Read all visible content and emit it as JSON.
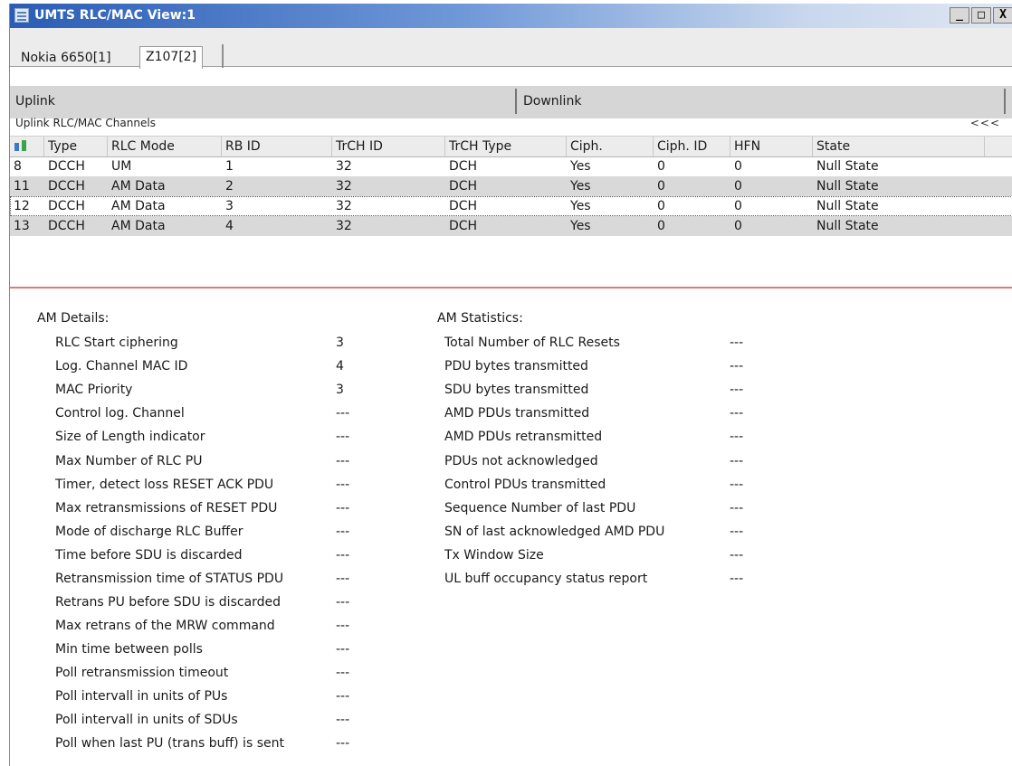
{
  "window": {
    "title": "UMTS RLC/MAC View:1",
    "controls": [
      "_",
      "□",
      "X"
    ]
  },
  "tabs": [
    {
      "label": "Nokia 6650[1]",
      "selected": false
    },
    {
      "label": "Z107[2]",
      "selected": true
    }
  ],
  "directions": {
    "uplink": "Uplink",
    "downlink": "Downlink"
  },
  "channels": {
    "title": "Uplink RLC/MAC Channels",
    "collapse_label": "<<<",
    "columns": [
      "",
      "Type",
      "RLC Mode",
      "RB ID",
      "TrCH ID",
      "TrCH Type",
      "Ciph.",
      "Ciph. ID",
      "HFN",
      "State"
    ],
    "rows": [
      [
        "8",
        "DCCH",
        "UM",
        "1",
        "32",
        "DCH",
        "Yes",
        "0",
        "0",
        "Null State"
      ],
      [
        "11",
        "DCCH",
        "AM Data",
        "2",
        "32",
        "DCH",
        "Yes",
        "0",
        "0",
        "Null State"
      ],
      [
        "12",
        "DCCH",
        "AM Data",
        "3",
        "32",
        "DCH",
        "Yes",
        "0",
        "0",
        "Null State"
      ],
      [
        "13",
        "DCCH",
        "AM Data",
        "4",
        "32",
        "DCH",
        "Yes",
        "0",
        "0",
        "Null State"
      ]
    ],
    "selected_row": 2
  },
  "am_details": {
    "title": "AM Details:",
    "items": [
      {
        "label": "RLC Start ciphering",
        "value": "3"
      },
      {
        "label": "Log. Channel MAC ID",
        "value": "4"
      },
      {
        "label": "MAC Priority",
        "value": "3"
      },
      {
        "label": "Control log. Channel",
        "value": "---"
      },
      {
        "label": "Size of Length indicator",
        "value": "---"
      },
      {
        "label": "Max Number of RLC PU",
        "value": "---"
      },
      {
        "label": "Timer, detect loss RESET ACK PDU",
        "value": "---"
      },
      {
        "label": "Max retransmissions of RESET PDU",
        "value": "---"
      },
      {
        "label": "Mode of discharge RLC Buffer",
        "value": "---"
      },
      {
        "label": "Time before SDU is discarded",
        "value": "---"
      },
      {
        "label": "Retransmission time of STATUS PDU",
        "value": "---"
      },
      {
        "label": "Retrans PU before SDU is discarded",
        "value": "---"
      },
      {
        "label": "Max retrans of the MRW command",
        "value": "---"
      },
      {
        "label": "Min time between polls",
        "value": "---"
      },
      {
        "label": "Poll retransmission timeout",
        "value": "---"
      },
      {
        "label": "Poll intervall in units of PUs",
        "value": "---"
      },
      {
        "label": "Poll intervall in units of SDUs",
        "value": "---"
      },
      {
        "label": "Poll when last PU (trans buff) is sent",
        "value": "---"
      }
    ]
  },
  "am_statistics": {
    "title": "AM Statistics:",
    "items": [
      {
        "label": "Total Number of RLC Resets",
        "value": "---"
      },
      {
        "label": "PDU bytes transmitted",
        "value": "---"
      },
      {
        "label": "SDU bytes transmitted",
        "value": "---"
      },
      {
        "label": "AMD PDUs transmitted",
        "value": "---"
      },
      {
        "label": "AMD PDUs retransmitted",
        "value": "---"
      },
      {
        "label": "PDUs not acknowledged",
        "value": "---"
      },
      {
        "label": "Control PDUs transmitted",
        "value": "---"
      },
      {
        "label": "Sequence Number of last PDU",
        "value": "---"
      },
      {
        "label": "SN of last acknowledged AMD PDU",
        "value": "---"
      },
      {
        "label": "Tx Window Size",
        "value": "---"
      },
      {
        "label": "UL buff occupancy status report",
        "value": "---"
      }
    ]
  }
}
